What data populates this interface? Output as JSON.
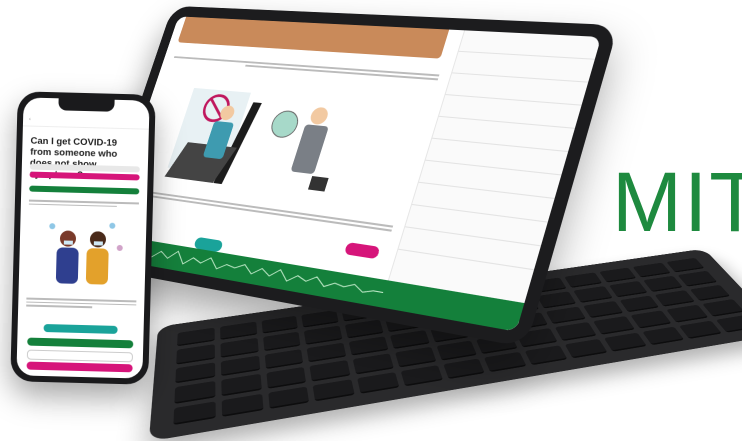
{
  "brand": {
    "logo_text": "MIT",
    "color": "#1e8a3f"
  },
  "colors": {
    "green": "#14803b",
    "pink": "#d6157a",
    "teal": "#1aa39a"
  },
  "phone": {
    "title": "Can I get COVID-19 from someone who does not show symptoms?",
    "icons": [
      "back-arrow-icon",
      "people-wearing-masks-illustration"
    ]
  },
  "tablet": {
    "icons": [
      "audio-waveform-icon",
      "play-icon",
      "person-with-luggage-illustration",
      "man-in-suit-illustration"
    ]
  },
  "keyboard": {
    "icons": [
      "keyboard-keys"
    ]
  }
}
